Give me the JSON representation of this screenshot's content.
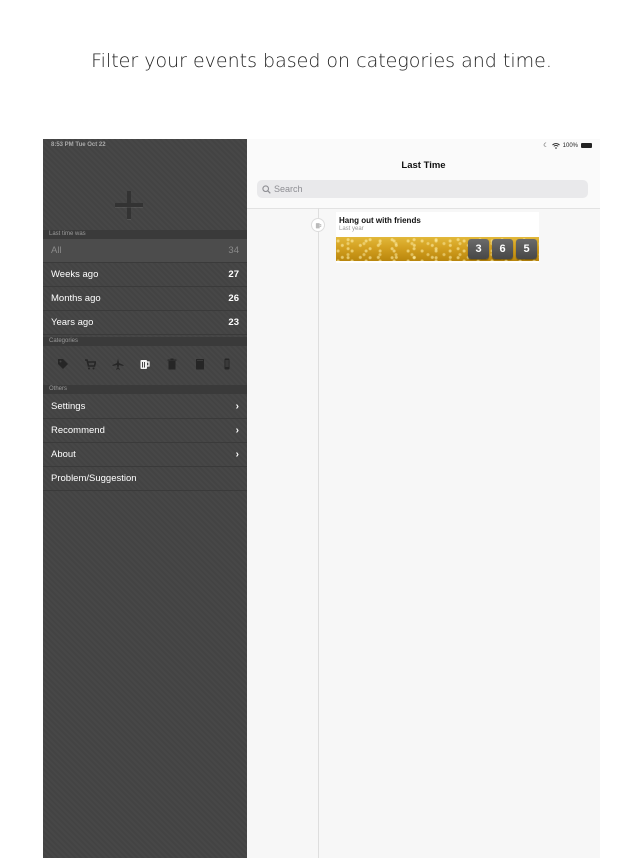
{
  "caption": "Filter your events based on categories and time.",
  "status": {
    "time": "8:53 PM   Tue Oct 22",
    "battery": "100%"
  },
  "sidebar": {
    "section_time": "Last time was",
    "filters": [
      {
        "label": "All",
        "count": "34"
      },
      {
        "label": "Weeks ago",
        "count": "27"
      },
      {
        "label": "Months ago",
        "count": "26"
      },
      {
        "label": "Years ago",
        "count": "23"
      }
    ],
    "section_categories": "Categories",
    "categories": [
      "tag-icon",
      "cart-icon",
      "airplane-icon",
      "beer-mug-icon",
      "trash-icon",
      "book-icon",
      "phone-icon"
    ],
    "section_others": "Others",
    "others": [
      {
        "label": "Settings"
      },
      {
        "label": "Recommend"
      },
      {
        "label": "About"
      },
      {
        "label": "Problem/Suggestion"
      }
    ]
  },
  "main": {
    "title": "Last Time",
    "search_placeholder": "Search",
    "event": {
      "title": "Hang out with friends",
      "subtitle": "Last year",
      "days": [
        "3",
        "6",
        "5"
      ]
    }
  }
}
